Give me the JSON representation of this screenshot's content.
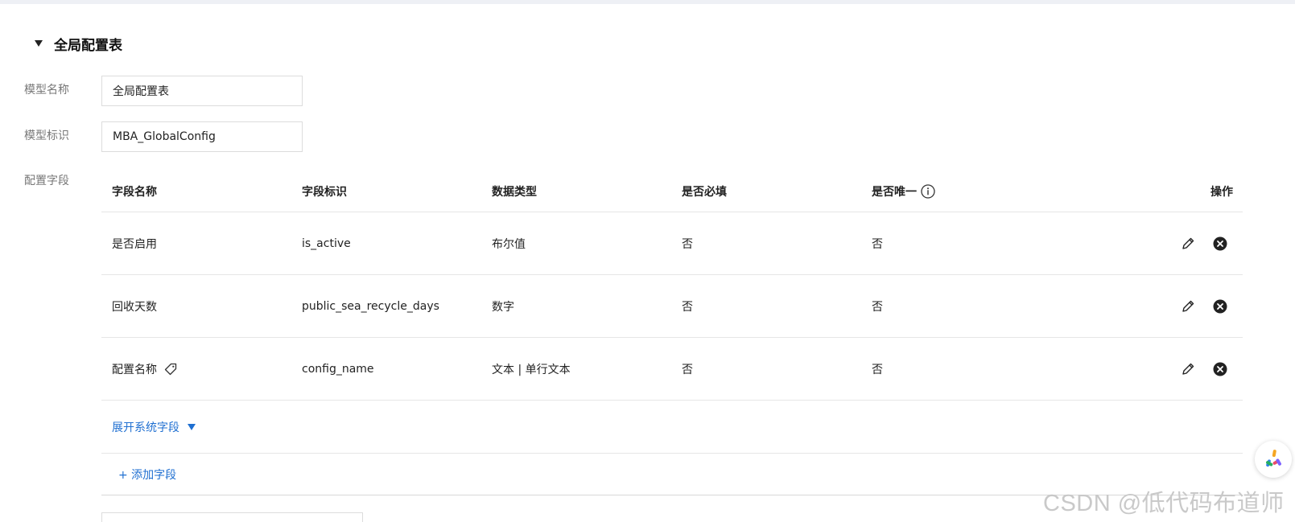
{
  "section": {
    "title": "全局配置表"
  },
  "form": {
    "model_name_label": "模型名称",
    "model_name_value": "全局配置表",
    "model_id_label": "模型标识",
    "model_id_value": "MBA_GlobalConfig",
    "config_fields_label": "配置字段"
  },
  "table": {
    "headers": {
      "field_name": "字段名称",
      "field_id": "字段标识",
      "data_type": "数据类型",
      "required": "是否必填",
      "unique": "是否唯一",
      "actions": "操作"
    },
    "rows": [
      {
        "name": "是否启用",
        "id": "is_active",
        "type": "布尔值",
        "required": "否",
        "unique": "否"
      },
      {
        "name": "回收天数",
        "id": "public_sea_recycle_days",
        "type": "数字",
        "required": "否",
        "unique": "否"
      },
      {
        "name": "配置名称",
        "id": "config_name",
        "type": "文本 | 单行文本",
        "required": "否",
        "unique": "否"
      }
    ],
    "expand_system_fields": "展开系统字段",
    "add_field": "+ 添加字段"
  },
  "icons": {
    "section_toggle": "caret-down-icon",
    "unique_info": "info-circle-icon",
    "primary_tag": "tag-icon",
    "edit": "pencil-icon",
    "delete": "close-circle-icon"
  },
  "colors": {
    "link": "#1f6fd1",
    "text": "#222222",
    "label": "#777777",
    "border": "#e6e6e6"
  },
  "watermark": "CSDN @低代码布道师"
}
